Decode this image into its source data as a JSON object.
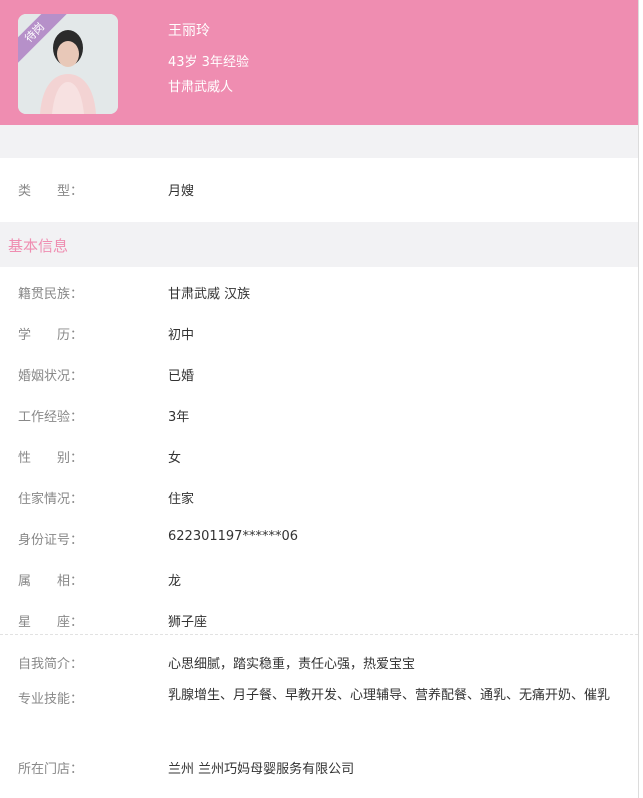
{
  "header": {
    "badge": "待岗",
    "name": "王丽玲",
    "meta": "43岁 3年经验",
    "origin": "甘肃武威人"
  },
  "type_row": {
    "label": "类　　型：",
    "value": "月嫂"
  },
  "section": {
    "title": "基本信息"
  },
  "details": [
    {
      "label": "籍贯民族：",
      "value": "甘肃武威 汉族"
    },
    {
      "label": "学　　历：",
      "value": "初中"
    },
    {
      "label": "婚姻状况：",
      "value": "已婚"
    },
    {
      "label": "工作经验：",
      "value": "3年"
    },
    {
      "label": "性　　别：",
      "value": "女"
    },
    {
      "label": "住家情况：",
      "value": "住家"
    },
    {
      "label": "身份证号：",
      "value": "622301197******06"
    },
    {
      "label": "属　　相：",
      "value": "龙"
    },
    {
      "label": "星　　座：",
      "value": "狮子座"
    }
  ],
  "extra": [
    {
      "label": "自我简介：",
      "value": "心思细腻，踏实稳重，责任心强，热爱宝宝"
    },
    {
      "label": "专业技能：",
      "value": "乳腺增生、月子餐、早教开发、心理辅导、营养配餐、通乳、无痛开奶、催乳"
    },
    {
      "label": "所在门店：",
      "value": "兰州 兰州巧妈母婴服务有限公司"
    }
  ]
}
